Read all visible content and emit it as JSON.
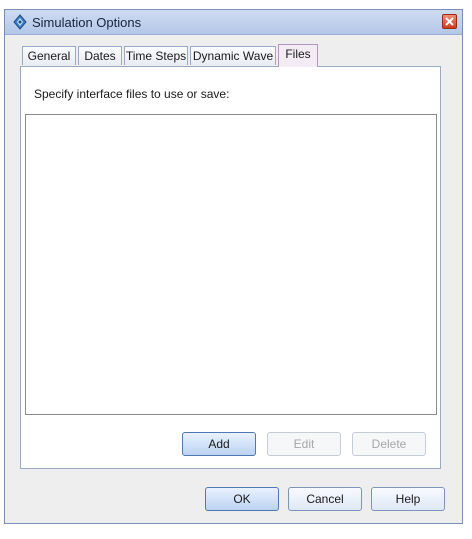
{
  "window": {
    "title": "Simulation Options",
    "icon": "simulation-app-icon",
    "close_icon": "close-icon"
  },
  "tabs": [
    {
      "label": "General",
      "active": false
    },
    {
      "label": "Dates",
      "active": false
    },
    {
      "label": "Time Steps",
      "active": false
    },
    {
      "label": "Dynamic Wave",
      "active": false
    },
    {
      "label": "Files",
      "active": true
    }
  ],
  "files_panel": {
    "instruction": "Specify interface files to use or save:",
    "files": [],
    "buttons": {
      "add": {
        "label": "Add",
        "enabled": true
      },
      "edit": {
        "label": "Edit",
        "enabled": false
      },
      "delete": {
        "label": "Delete",
        "enabled": false
      }
    }
  },
  "dialog_buttons": {
    "ok": "OK",
    "cancel": "Cancel",
    "help": "Help"
  },
  "colors": {
    "titlebar": "#c1d2ee",
    "close_button": "#d9472f",
    "active_tab": "#f4ecf4",
    "primary_button_border": "#4f77b3"
  }
}
